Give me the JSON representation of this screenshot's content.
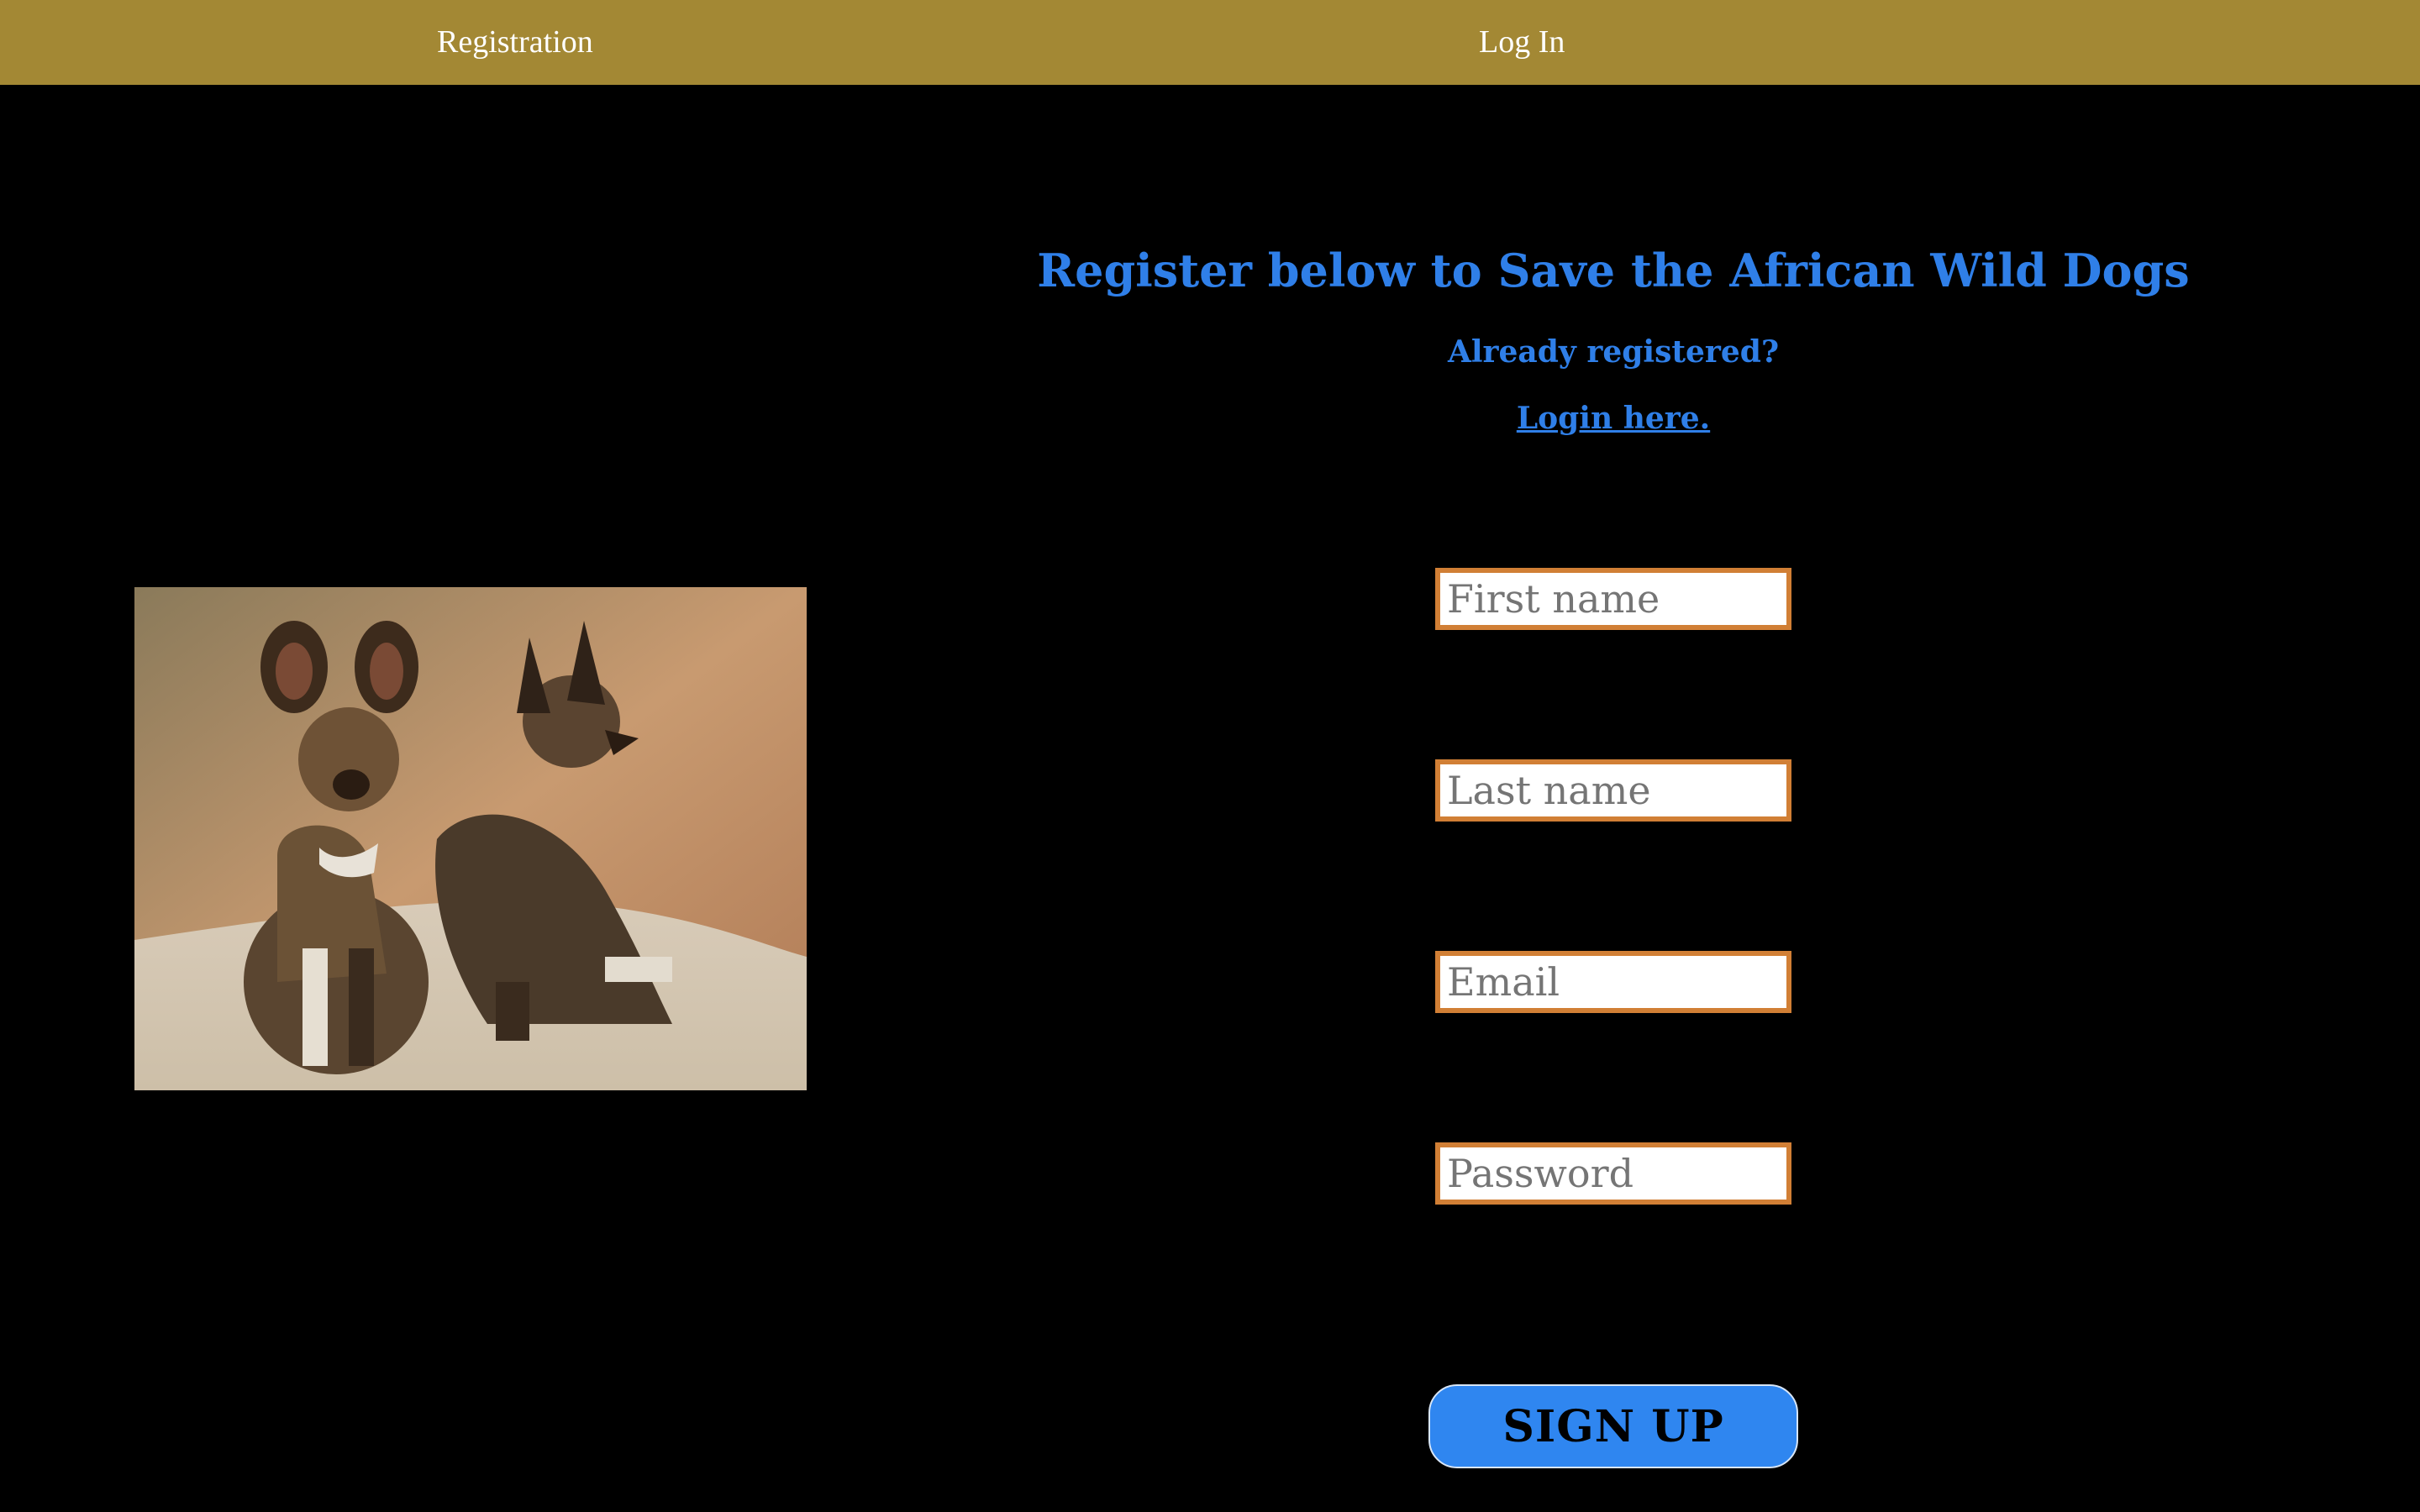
{
  "nav": {
    "registration_label": "Registration",
    "login_label": "Log In"
  },
  "main": {
    "heading": "Register below to Save the African Wild Dogs",
    "already_registered": "Already registered?",
    "login_link": "Login here."
  },
  "form": {
    "first_name_placeholder": "First name",
    "last_name_placeholder": "Last name",
    "email_placeholder": "Email",
    "password_placeholder": "Password",
    "signup_label": "SIGN UP"
  },
  "colors": {
    "nav_bg": "#a38834",
    "accent_blue": "#2f7fe8",
    "field_border": "#d17f35",
    "button_bg": "#2f86f0"
  }
}
